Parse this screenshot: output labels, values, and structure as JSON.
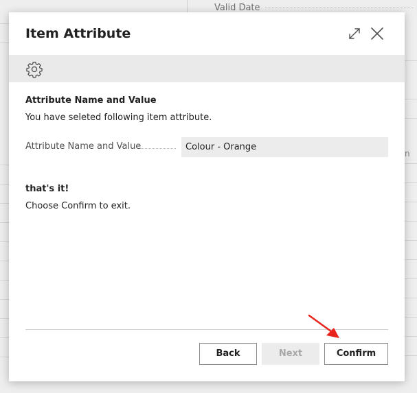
{
  "background": {
    "column_header": "Valid Date",
    "right_fragment": "n"
  },
  "dialog": {
    "title": "Item Attribute",
    "expand_icon": "expand-icon",
    "close_icon": "close-icon",
    "toolbar_icon": "gear-icon",
    "section_title": "Attribute Name and Value",
    "section_description": "You have seleted following item attribute.",
    "field": {
      "label": "Attribute Name and Value",
      "value": "Colour - Orange"
    },
    "done_title": "that's it!",
    "done_description": "Choose Confirm to exit.",
    "buttons": {
      "back": "Back",
      "next": "Next",
      "confirm": "Confirm",
      "next_disabled": true
    }
  },
  "annotation": {
    "arrow_color": "#e8231c"
  }
}
